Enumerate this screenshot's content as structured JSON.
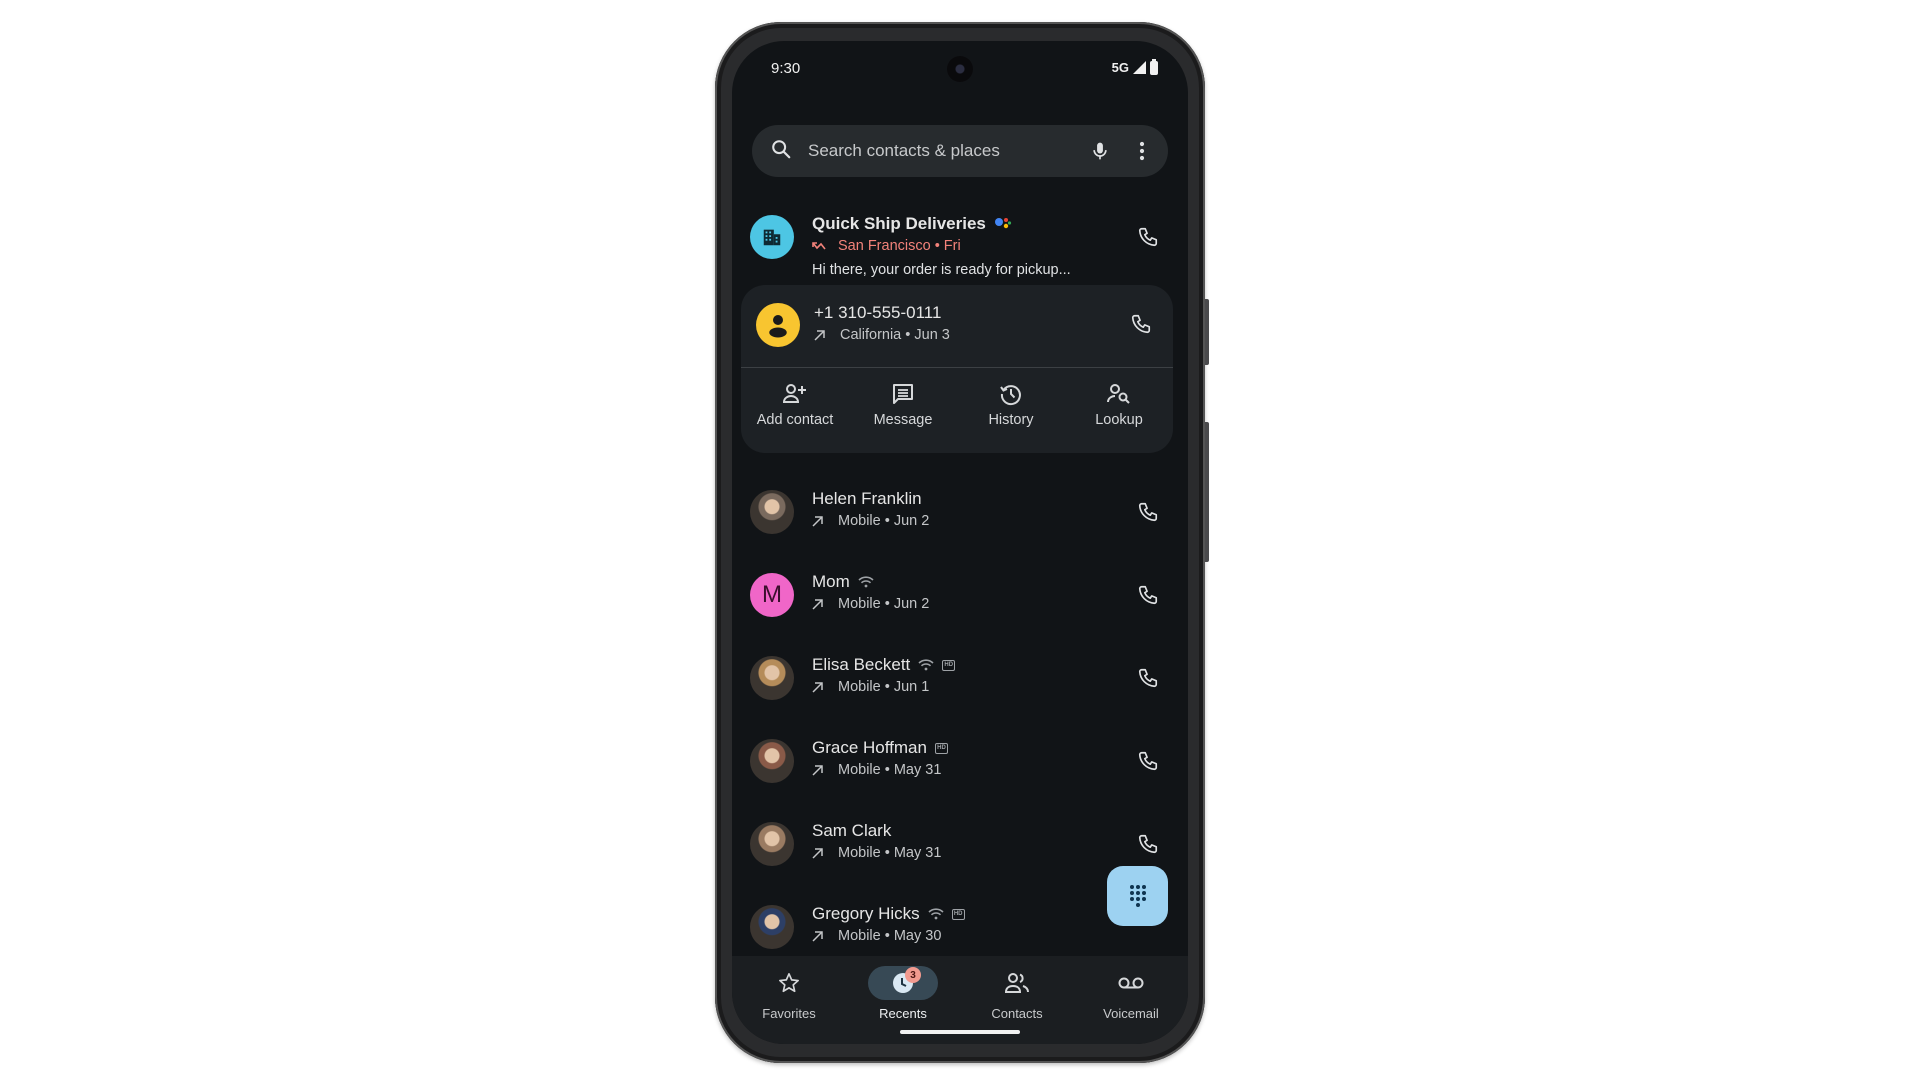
{
  "status_bar": {
    "time": "9:30",
    "network": "5G"
  },
  "search": {
    "placeholder": "Search contacts & places"
  },
  "calls": [
    {
      "name": "Quick Ship Deliveries",
      "detail": "San Francisco • Fri",
      "preview": "Hi there, your order is ready for pickup...",
      "type": "missed",
      "avatar": "business",
      "color": "#4dc6e4",
      "badges": [
        "assistant"
      ]
    },
    {
      "name": "+1 310-555-0111",
      "detail": "California • Jun 3",
      "type": "outgoing",
      "avatar": "person-placeholder",
      "color": "#f8c530",
      "expanded": true
    },
    {
      "name": "Helen Franklin",
      "detail": "Mobile • Jun 2",
      "type": "outgoing",
      "avatar": "photo",
      "color": "#7a6a5e"
    },
    {
      "name": "Mom",
      "detail": "Mobile • Jun 2",
      "type": "outgoing",
      "avatar": "letter",
      "letter": "M",
      "color": "#f066c8",
      "badges": [
        "wifi"
      ]
    },
    {
      "name": "Elisa Beckett",
      "detail": "Mobile • Jun 1",
      "type": "outgoing",
      "avatar": "photo",
      "color": "#b58c5a",
      "badges": [
        "wifi",
        "hd"
      ]
    },
    {
      "name": "Grace Hoffman",
      "detail": "Mobile • May 31",
      "type": "outgoing",
      "avatar": "photo",
      "color": "#8a5a48",
      "badges": [
        "hd"
      ]
    },
    {
      "name": "Sam Clark",
      "detail": "Mobile • May 31",
      "type": "outgoing",
      "avatar": "photo",
      "color": "#9a7b62"
    },
    {
      "name": "Gregory Hicks",
      "detail": "Mobile • May 30",
      "type": "outgoing",
      "avatar": "photo",
      "color": "#2d3f66",
      "badges": [
        "wifi",
        "hd"
      ]
    }
  ],
  "expanded_actions": [
    {
      "label": "Add contact",
      "icon": "person-add-icon"
    },
    {
      "label": "Message",
      "icon": "message-icon"
    },
    {
      "label": "History",
      "icon": "history-icon"
    },
    {
      "label": "Lookup",
      "icon": "person-search-icon"
    }
  ],
  "nav": [
    {
      "label": "Favorites",
      "icon": "star-icon"
    },
    {
      "label": "Recents",
      "icon": "clock-icon",
      "active": true,
      "badge": "3"
    },
    {
      "label": "Contacts",
      "icon": "people-icon"
    },
    {
      "label": "Voicemail",
      "icon": "voicemail-icon"
    }
  ],
  "hd_label": "HD"
}
